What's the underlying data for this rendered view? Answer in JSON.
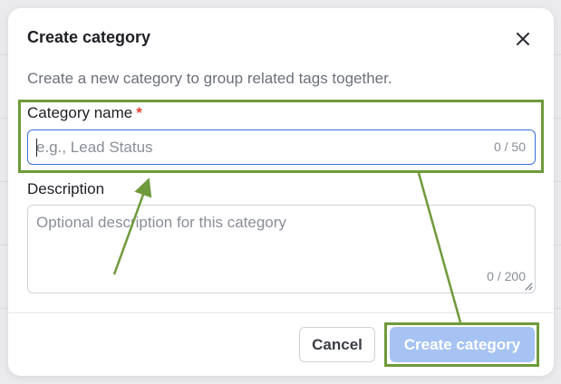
{
  "modal": {
    "title": "Create category",
    "subtitle": "Create a new category to group related tags together."
  },
  "fields": {
    "name": {
      "label": "Category name",
      "required_marker": "*",
      "placeholder": "e.g., Lead Status",
      "value": "",
      "char_count": "0 / 50"
    },
    "description": {
      "label": "Description",
      "placeholder": "Optional description for this category",
      "value": "",
      "char_count": "0 / 200"
    }
  },
  "footer": {
    "cancel_label": "Cancel",
    "create_label": "Create category"
  },
  "icons": {
    "close": "close-icon",
    "resize": "resize-grip-icon"
  },
  "colors": {
    "focus_border": "#3b6fd9",
    "primary_disabled": "#a7c3f4",
    "required": "#e0453a",
    "annotation": "#6f9a3b"
  }
}
